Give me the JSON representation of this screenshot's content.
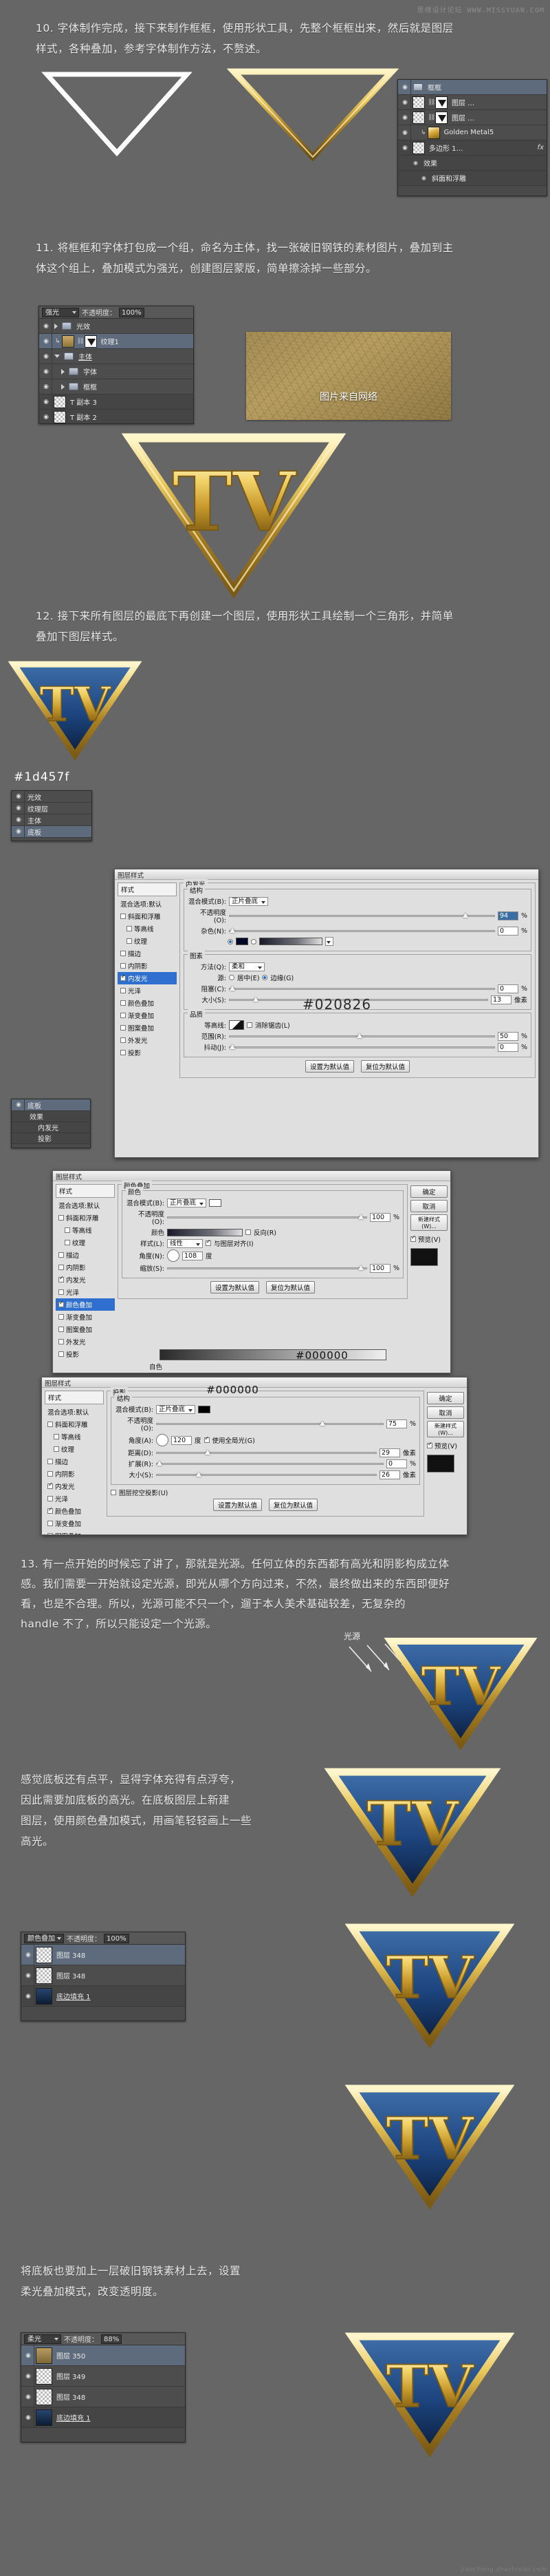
{
  "watermark": {
    "top": "思缘设计论坛  WWW.MISSYUAN.COM",
    "bottom": "jiaocheng.zhazhixler.com"
  },
  "steps": {
    "s10": "10. 字体制作完成，接下来制作框框，使用形状工具，先整个框框出来，然后就是图层\n样式，各种叠加，参考字体制作方法，不赘述。",
    "s11": "11. 将框框和字体打包成一个组，命名为主体，找一张破旧钢铁的素材图片，叠加到主\n体这个组上，叠加模式为强光，创建图层蒙版，简单擦涂掉一些部分。",
    "s12": "12. 接下来所有图层的最底下再创建一个图层，使用形状工具绘制一个三角形，并简单\n叠加下图层样式。",
    "s13": "13. 有一点开始的时候忘了讲了，那就是光源。任何立体的东西都有高光和阴影构成立体\n感。我们需要一开始就设定光源，即光从哪个方向过来，不然，最终做出来的东西即便好\n看，也是不合理。所以，光源可能不只一个，遛于本人美术基础较差，无复杂的\nhandle 不了，所以只能设定一个光源。",
    "s13b": "感觉底板还有点平，显得字体充得有点浮夸，\n因此需要加底板的高光。在底板图层上新建\n图层，使用颜色叠加模式，用画笔轻轻画上一些\n高光。",
    "s14": "将底板也要加上一层破旧钢铁素材上去，设置\n柔光叠加模式，改变透明度。"
  },
  "texture_note": "图片来自网络",
  "panel_step11": {
    "blend_mode": "强光",
    "opacity_label": "不透明度：",
    "opacity_value": "100%",
    "rows": [
      {
        "name": "光效",
        "type": "group",
        "collapsed": true
      },
      {
        "name": "纹理1",
        "type": "layer",
        "selected": true,
        "clipped": true
      },
      {
        "name": "主体",
        "type": "group",
        "collapsed": false,
        "underline": true
      },
      {
        "name": "字体",
        "type": "group",
        "collapsed": true,
        "indent": 1
      },
      {
        "name": "框框",
        "type": "group",
        "collapsed": true,
        "indent": 1
      },
      {
        "name": "T 副本 3",
        "type": "layer"
      },
      {
        "name": "T 副本 2",
        "type": "layer"
      }
    ]
  },
  "panel_step10": {
    "rows": [
      {
        "name": "框框",
        "type": "group",
        "selected": true
      },
      {
        "name": "图层 …",
        "type": "layer"
      },
      {
        "name": "图层 …",
        "type": "layer"
      },
      {
        "name": "Golden Metal5",
        "type": "layer",
        "clipped": true
      },
      {
        "name": "多边形 1…",
        "type": "layer",
        "fx": "fx"
      },
      {
        "name": "效果",
        "type": "effect"
      },
      {
        "name": "斜面和浮雕",
        "type": "effect",
        "indent": 1
      }
    ]
  },
  "panel_step12": {
    "rows": [
      {
        "name": "光效",
        "type": "group"
      },
      {
        "name": "纹理层",
        "type": "layer"
      },
      {
        "name": "主体",
        "type": "group"
      },
      {
        "name": "底板",
        "type": "layer",
        "selected": true
      }
    ]
  },
  "panel_step13": {
    "blend_mode": "颜色叠加",
    "opacity_label": "不透明度：",
    "opacity_value": "100%",
    "rows": [
      {
        "name": "图层 348",
        "type": "layer",
        "selected": true
      },
      {
        "name": "图层 348",
        "type": "layer"
      },
      {
        "name": "底边填充 1",
        "type": "layer",
        "underline": true
      }
    ]
  },
  "panel_step14": {
    "blend_mode": "柔光",
    "opacity_label": "不透明度：",
    "opacity_value": "88%",
    "rows": [
      {
        "name": "图层 350",
        "type": "layer",
        "selected": true
      },
      {
        "name": "图层 349",
        "type": "layer"
      },
      {
        "name": "图层 348",
        "type": "layer"
      },
      {
        "name": "底边填充 1",
        "type": "layer",
        "underline": true
      }
    ]
  },
  "dialog_inner_glow": {
    "title": "图层样式",
    "styles_header": "样式",
    "blend_default": "混合选项:默认",
    "style_items": [
      {
        "label": "斜面和浮雕",
        "checked": false
      },
      {
        "label": "等高线",
        "checked": false,
        "indent": 1
      },
      {
        "label": "纹理",
        "checked": false,
        "indent": 1
      },
      {
        "label": "描边",
        "checked": false
      },
      {
        "label": "内阴影",
        "checked": false
      },
      {
        "label": "内发光",
        "checked": true,
        "active": true
      },
      {
        "label": "光泽",
        "checked": false
      },
      {
        "label": "颜色叠加",
        "checked": false
      },
      {
        "label": "渐变叠加",
        "checked": false
      },
      {
        "label": "图案叠加",
        "checked": false
      },
      {
        "label": "外发光",
        "checked": false
      },
      {
        "label": "投影",
        "checked": false
      }
    ],
    "section_title": "内发光",
    "group_structure": "结构",
    "blend_mode_label": "混合模式(B):",
    "blend_mode_value": "正片叠底",
    "opacity_label": "不透明度(O):",
    "opacity_value": "94",
    "noise_label": "杂色(N):",
    "noise_value": "0",
    "color_hex": "#020826",
    "group_elements": "图素",
    "method_label": "方法(Q):",
    "method_value": "柔和",
    "source_label": "源:",
    "source_center": "居中(E)",
    "source_edge": "边缘(G)",
    "choke_label": "阻塞(C):",
    "choke_value": "0",
    "size_label": "大小(S):",
    "size_value": "13",
    "px_unit": "像素",
    "group_quality": "品质",
    "contour_label": "等高线:",
    "antialias_label": "消除锯齿(L)",
    "range_label": "范围(R):",
    "range_value": "50",
    "jitter_label": "抖动(J):",
    "jitter_value": "0",
    "btn_set_default": "设置为默认值",
    "btn_reset_default": "复位为默认值",
    "pct": "%"
  },
  "dialog_gradient": {
    "title": "图层样式",
    "styles_header": "样式",
    "blend_default": "混合选项:默认",
    "style_items": [
      {
        "label": "斜面和浮雕",
        "checked": false
      },
      {
        "label": "等高线",
        "checked": false,
        "indent": 1
      },
      {
        "label": "纹理",
        "checked": false,
        "indent": 1
      },
      {
        "label": "描边",
        "checked": false
      },
      {
        "label": "内阴影",
        "checked": false
      },
      {
        "label": "内发光",
        "checked": false
      },
      {
        "label": "光泽",
        "checked": false
      },
      {
        "label": "颜色叠加",
        "checked": false
      },
      {
        "label": "渐变叠加",
        "checked": true,
        "active": true
      },
      {
        "label": "图案叠加",
        "checked": false
      },
      {
        "label": "外发光",
        "checked": false
      },
      {
        "label": "投影",
        "checked": false
      }
    ],
    "section_title": "颜色叠加",
    "group_structure": "颜色",
    "blend_mode_label": "混合模式(B):",
    "blend_mode_value": "正片叠底",
    "opacity_label": "不透明度(O):",
    "opacity_value": "100",
    "reverse_label": "反向(R)",
    "style_label": "样式(L):",
    "style_value": "线性",
    "align_label": "与图层对齐(I)",
    "angle_label": "角度(N):",
    "angle_value": "108",
    "degree": "度",
    "scale_label": "缩放(S):",
    "scale_value": "100",
    "btn_set_default": "设置为默认值",
    "btn_reset_default": "复位为默认值",
    "bottom_hex": "#000000",
    "bottom_label": "自色",
    "pct": "%",
    "buttons": {
      "ok": "确定",
      "cancel": "取消",
      "new_style": "新建样式(W)...",
      "preview": "预览(V)"
    }
  },
  "dialog_shadow": {
    "title": "图层样式",
    "section_title": "投影",
    "group_structure": "结构",
    "hex": "#000000",
    "blend_mode_label": "混合模式(B):",
    "blend_mode_value": "正片叠底",
    "opacity_label": "不透明度(O):",
    "opacity_value": "75",
    "angle_label": "角度(A):",
    "angle_value": "120",
    "use_global": "使用全局光(G)",
    "distance_label": "距离(D):",
    "distance_value": "29",
    "spread_label": "扩展(R):",
    "spread_value": "0",
    "size_label": "大小(S):",
    "size_value": "26",
    "px_unit": "像素",
    "pct": "%",
    "degree": "度",
    "layer_knockout": "图层挖空投影(U)",
    "btn_set_default": "设置为默认值",
    "btn_reset_default": "复位为默认值",
    "buttons": {
      "ok": "确定",
      "cancel": "取消",
      "new_style": "新建样式(W)...",
      "preview": "预览(V)"
    }
  },
  "hex_notes": {
    "blue": "#1d457f",
    "inner_glow": "#020826",
    "black1": "#000000",
    "black2": "#000000"
  },
  "light_source_label": "光源",
  "emblem_text": "TV"
}
